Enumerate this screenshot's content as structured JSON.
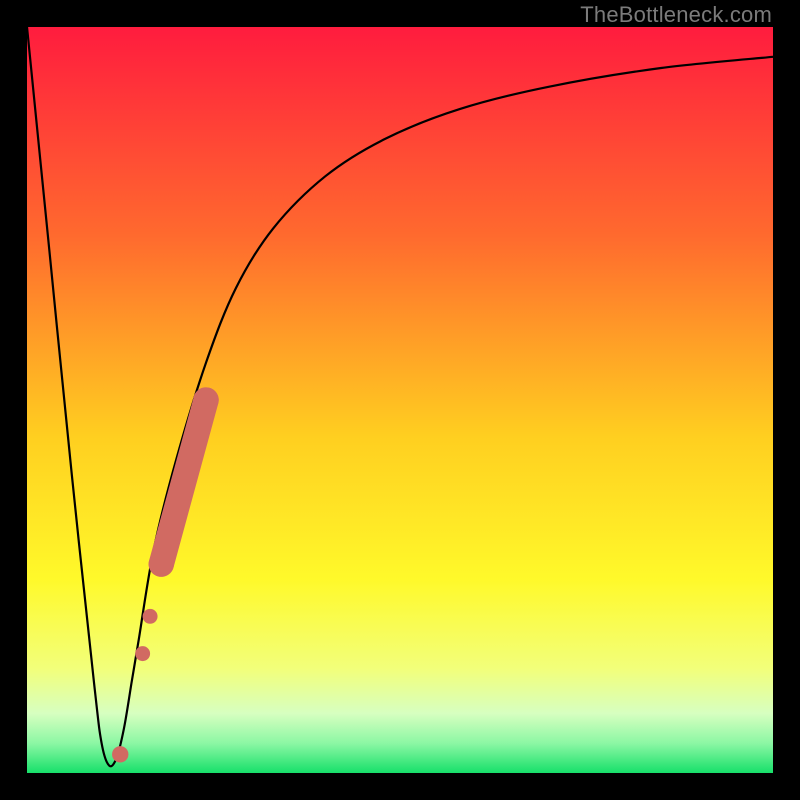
{
  "watermark": "TheBottleneck.com",
  "colors": {
    "frame": "#000000",
    "curve": "#000000",
    "dots": "#d16a62",
    "gradient": {
      "top": "#ff1c3e",
      "upper_mid": "#ff8a2a",
      "mid": "#ffe326",
      "lower_mid": "#f6ff43",
      "pale": "#e6ffcf",
      "bottom": "#17e06a"
    }
  },
  "chart_data": {
    "type": "line",
    "title": "",
    "xlabel": "",
    "ylabel": "",
    "xlim": [
      0,
      100
    ],
    "ylim": [
      0,
      100
    ],
    "grid": false,
    "series": [
      {
        "name": "bottleneck-curve",
        "x": [
          0,
          3,
          6,
          9,
          10,
          11,
          12,
          13,
          14,
          15,
          17,
          20,
          24,
          28,
          33,
          40,
          48,
          58,
          70,
          85,
          100
        ],
        "y": [
          100,
          70,
          40,
          12,
          4,
          1,
          2,
          6,
          12,
          18,
          30,
          42,
          55,
          65,
          73,
          80,
          85,
          89,
          92,
          94.5,
          96
        ]
      }
    ],
    "markers": [
      {
        "name": "bottom-dot",
        "x": 12.5,
        "y": 2.5,
        "r": 1.1
      },
      {
        "name": "small-dot-1",
        "x": 15.5,
        "y": 16,
        "r": 1.0
      },
      {
        "name": "small-dot-2",
        "x": 16.5,
        "y": 21,
        "r": 1.0
      },
      {
        "name": "segment-start",
        "x": 18.0,
        "y": 28,
        "r": 1.7
      },
      {
        "name": "segment-end",
        "x": 24.0,
        "y": 50,
        "r": 1.7
      }
    ],
    "segments": [
      {
        "name": "thick-diagonal",
        "x1": 18.0,
        "y1": 28,
        "x2": 24.0,
        "y2": 50,
        "width": 3.4
      }
    ]
  }
}
